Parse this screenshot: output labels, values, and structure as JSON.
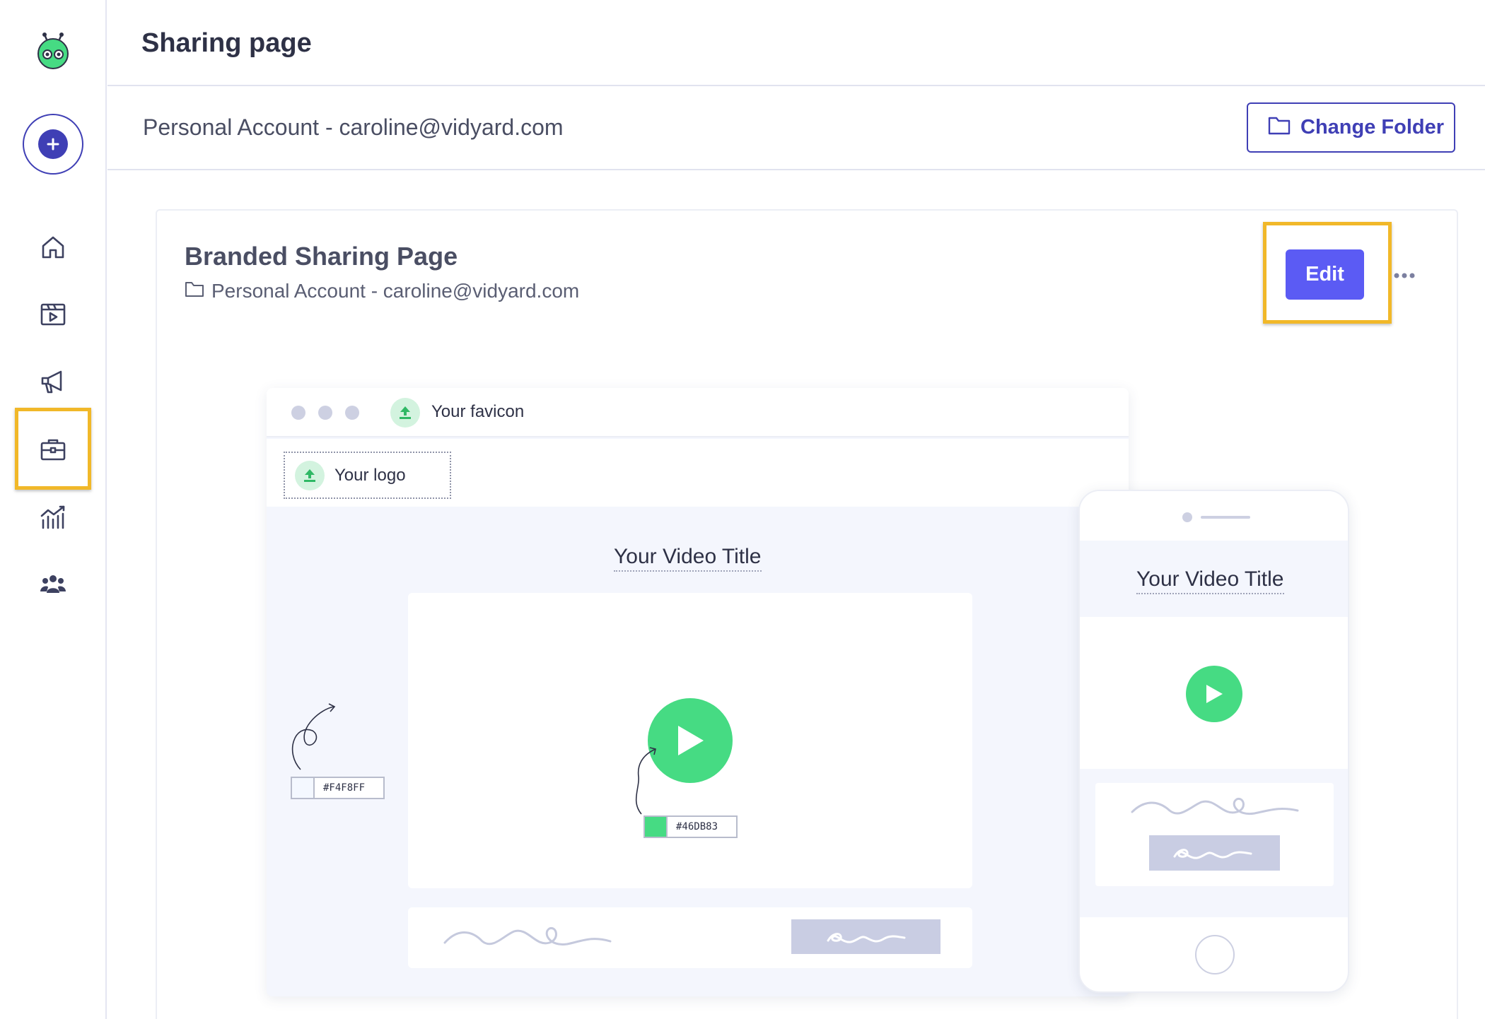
{
  "header": {
    "title": "Sharing page"
  },
  "account_bar": {
    "account": "Personal Account - caroline@vidyard.com",
    "change_folder_label": "Change Folder"
  },
  "card": {
    "title": "Branded Sharing Page",
    "folder": "Personal Account - caroline@vidyard.com",
    "edit_label": "Edit"
  },
  "preview": {
    "favicon_label": "Your favicon",
    "logo_label": "Your logo",
    "video_title": "Your Video Title",
    "background_hex": "#F4F8FF",
    "accent_hex": "#46DB83",
    "mobile_video_title": "Your Video Title"
  },
  "sidebar": {
    "items": [
      "home-icon",
      "videos-icon",
      "campaigns-icon",
      "sharing-pages-icon",
      "analytics-icon",
      "team-icon"
    ],
    "active": "sharing-pages-icon"
  },
  "colors": {
    "primary": "#3f3fb5",
    "button": "#5b5bf4",
    "accent_green": "#46db83",
    "highlight": "#f1b829"
  }
}
